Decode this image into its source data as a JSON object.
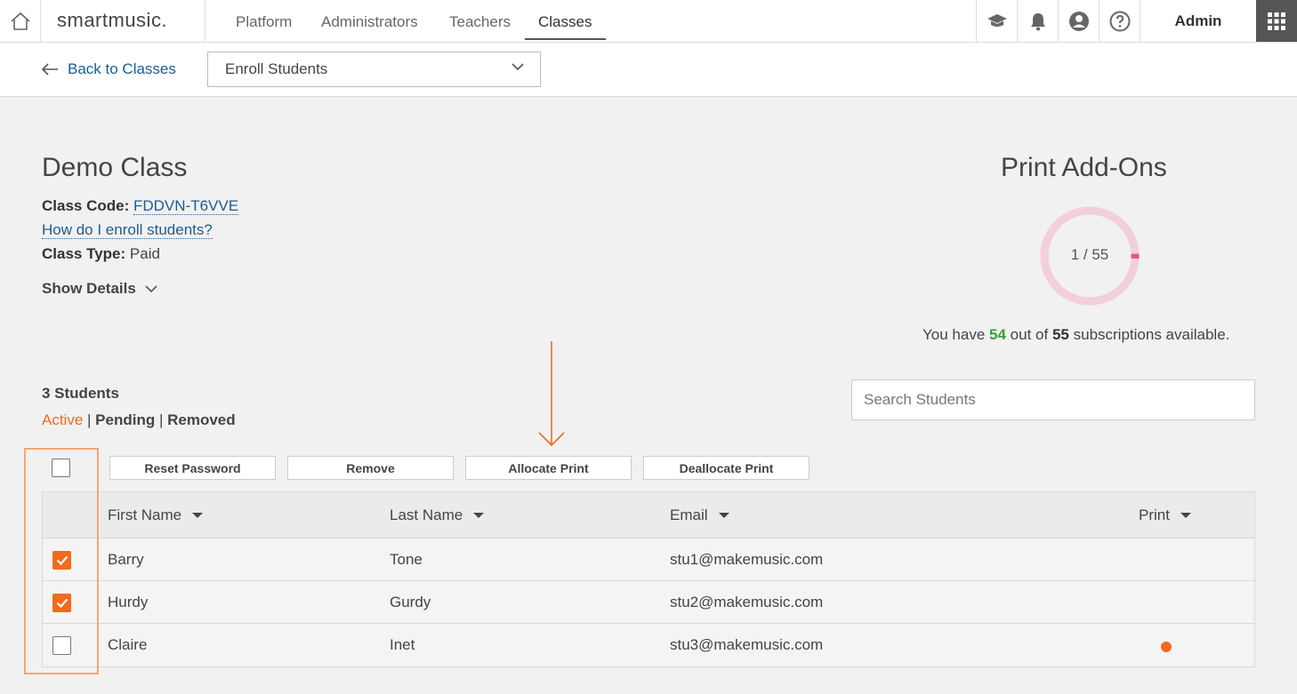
{
  "nav": {
    "logo": "smartmusic.",
    "items": [
      "Platform",
      "Administrators",
      "Teachers",
      "Classes"
    ],
    "user": "Admin"
  },
  "subbar": {
    "back_label": "Back to Classes",
    "dropdown_value": "Enroll Students"
  },
  "class_info": {
    "title": "Demo Class",
    "code_label": "Class Code:",
    "code_value": "FDDVN-T6VVE",
    "help_link": "How do I enroll students?",
    "type_label": "Class Type:",
    "type_value": "Paid",
    "show_details": "Show Details"
  },
  "print_addons": {
    "title": "Print Add-Ons",
    "used": 1,
    "total": 55,
    "donut_label": "1 / 55",
    "subs_prefix": "You have",
    "subs_available": "54",
    "subs_mid": "out of",
    "subs_total": "55",
    "subs_suffix": "subscriptions available.",
    "ring_color": "#f2cfd9",
    "fill_color": "#e0548a"
  },
  "students": {
    "count_label": "3 Students",
    "filter_active": "Active",
    "filter_pending": "Pending",
    "filter_removed": "Removed",
    "search_placeholder": "Search Students"
  },
  "actions": {
    "reset_password": "Reset Password",
    "remove": "Remove",
    "allocate_print": "Allocate Print",
    "deallocate_print": "Deallocate Print"
  },
  "table": {
    "headers": {
      "first_name": "First Name",
      "last_name": "Last Name",
      "email": "Email",
      "print": "Print"
    },
    "rows": [
      {
        "checked": true,
        "first": "Barry",
        "last": "Tone",
        "email": "stu1@makemusic.com",
        "print": false
      },
      {
        "checked": true,
        "first": "Hurdy",
        "last": "Gurdy",
        "email": "stu2@makemusic.com",
        "print": false
      },
      {
        "checked": false,
        "first": "Claire",
        "last": "Inet",
        "email": "stu3@makemusic.com",
        "print": true
      }
    ]
  },
  "colors": {
    "accent": "#f26a1b",
    "link": "#1a5d92",
    "green": "#3c9e3c"
  }
}
